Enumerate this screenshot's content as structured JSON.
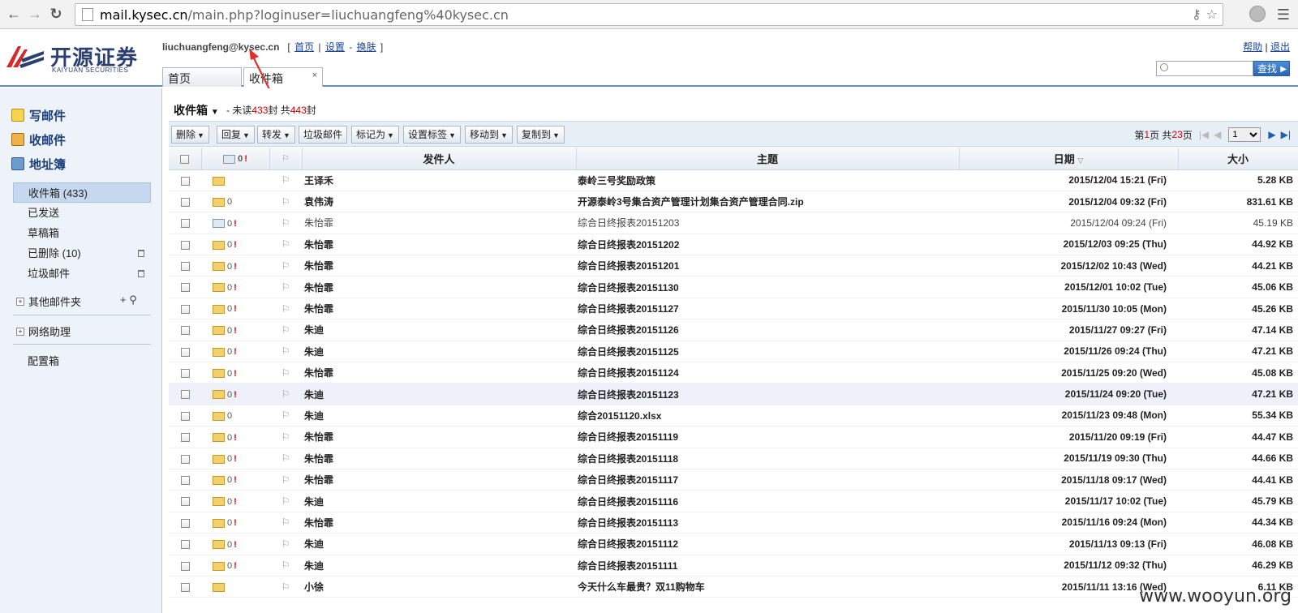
{
  "browser": {
    "url_host": "mail.kysec.cn",
    "url_path": "/main.php?loginuser=liuchuangfeng%40kysec.cn"
  },
  "header": {
    "logo_cn": "开源证券",
    "logo_en": "KAIYUAN SECURITIES",
    "username": "liuchuangfeng@kysec.cn",
    "links": [
      "首页",
      "设置",
      "换肤"
    ],
    "help": "帮助",
    "logout": "退出",
    "search_button": "查找",
    "tabs": [
      {
        "label": "首页"
      },
      {
        "label": "收件箱"
      }
    ]
  },
  "sidebar": {
    "quick": [
      {
        "label": "写邮件"
      },
      {
        "label": "收邮件"
      },
      {
        "label": "地址簿"
      }
    ],
    "folders": [
      {
        "label": "收件箱 (433)"
      },
      {
        "label": "已发送"
      },
      {
        "label": "草稿箱"
      },
      {
        "label": "已删除 (10)"
      },
      {
        "label": "垃圾邮件"
      }
    ],
    "other_folders": "其他邮件夹",
    "network_helper": "网络助理",
    "config_box": "配置箱"
  },
  "main": {
    "title": "收件箱",
    "sub_prefix": "- 未读",
    "unread": "433",
    "sub_mid": "封 共",
    "total": "443",
    "sub_suffix": "封",
    "toolbar": [
      "删除",
      "回复",
      "转发",
      "垃圾邮件",
      "标记为",
      "设置标签",
      "移动到",
      "复制到"
    ],
    "pager": {
      "prefix": "第",
      "page": "1",
      "mid": "页 共",
      "pages": "23",
      "suffix": "页",
      "select": "1"
    },
    "columns": {
      "sender": "发件人",
      "subject": "主题",
      "date": "日期",
      "size": "大小"
    },
    "rows": [
      {
        "sender": "王译禾",
        "subject": "泰岭三号奖励政策",
        "date": "2015/12/04 15:21 (Fri)",
        "size": "5.28 KB"
      },
      {
        "sender": "袁伟涛",
        "subject": "开源泰岭3号集合资产管理计划集合资产管理合同.zip",
        "date": "2015/12/04 09:32 (Fri)",
        "size": "831.61 KB"
      },
      {
        "sender": "朱怡霏",
        "subject": "综合日终报表20151203",
        "date": "2015/12/04 09:24 (Fri)",
        "size": "45.19 KB"
      },
      {
        "sender": "朱怡霏",
        "subject": "综合日终报表20151202",
        "date": "2015/12/03 09:25 (Thu)",
        "size": "44.92 KB"
      },
      {
        "sender": "朱怡霏",
        "subject": "综合日终报表20151201",
        "date": "2015/12/02 10:43 (Wed)",
        "size": "44.21 KB"
      },
      {
        "sender": "朱怡霏",
        "subject": "综合日终报表20151130",
        "date": "2015/12/01 10:02 (Tue)",
        "size": "45.06 KB"
      },
      {
        "sender": "朱怡霏",
        "subject": "综合日终报表20151127",
        "date": "2015/11/30 10:05 (Mon)",
        "size": "45.26 KB"
      },
      {
        "sender": "朱迪",
        "subject": "综合日终报表20151126",
        "date": "2015/11/27 09:27 (Fri)",
        "size": "47.14 KB"
      },
      {
        "sender": "朱迪",
        "subject": "综合日终报表20151125",
        "date": "2015/11/26 09:24 (Thu)",
        "size": "47.21 KB"
      },
      {
        "sender": "朱怡霏",
        "subject": "综合日终报表20151124",
        "date": "2015/11/25 09:20 (Wed)",
        "size": "45.08 KB"
      },
      {
        "sender": "朱迪",
        "subject": "综合日终报表20151123",
        "date": "2015/11/24 09:20 (Tue)",
        "size": "47.21 KB"
      },
      {
        "sender": "朱迪",
        "subject": "综合20151120.xlsx",
        "date": "2015/11/23 09:48 (Mon)",
        "size": "55.34 KB"
      },
      {
        "sender": "朱怡霏",
        "subject": "综合日终报表20151119",
        "date": "2015/11/20 09:19 (Fri)",
        "size": "44.47 KB"
      },
      {
        "sender": "朱怡霏",
        "subject": "综合日终报表20151118",
        "date": "2015/11/19 09:30 (Thu)",
        "size": "44.66 KB"
      },
      {
        "sender": "朱怡霏",
        "subject": "综合日终报表20151117",
        "date": "2015/11/18 09:17 (Wed)",
        "size": "44.41 KB"
      },
      {
        "sender": "朱迪",
        "subject": "综合日终报表20151116",
        "date": "2015/11/17 10:02 (Tue)",
        "size": "45.79 KB"
      },
      {
        "sender": "朱怡霏",
        "subject": "综合日终报表20151113",
        "date": "2015/11/16 09:24 (Mon)",
        "size": "44.34 KB"
      },
      {
        "sender": "朱迪",
        "subject": "综合日终报表20151112",
        "date": "2015/11/13 09:13 (Fri)",
        "size": "46.08 KB"
      },
      {
        "sender": "朱迪",
        "subject": "综合日终报表20151111",
        "date": "2015/11/12 09:32 (Thu)",
        "size": "46.29 KB"
      },
      {
        "sender": "小徐",
        "subject": "今天什么车最贵？双11购物车",
        "date": "2015/11/11 13:16 (Wed)",
        "size": "6.11 KB"
      }
    ]
  },
  "watermark": "www.wooyun.org"
}
